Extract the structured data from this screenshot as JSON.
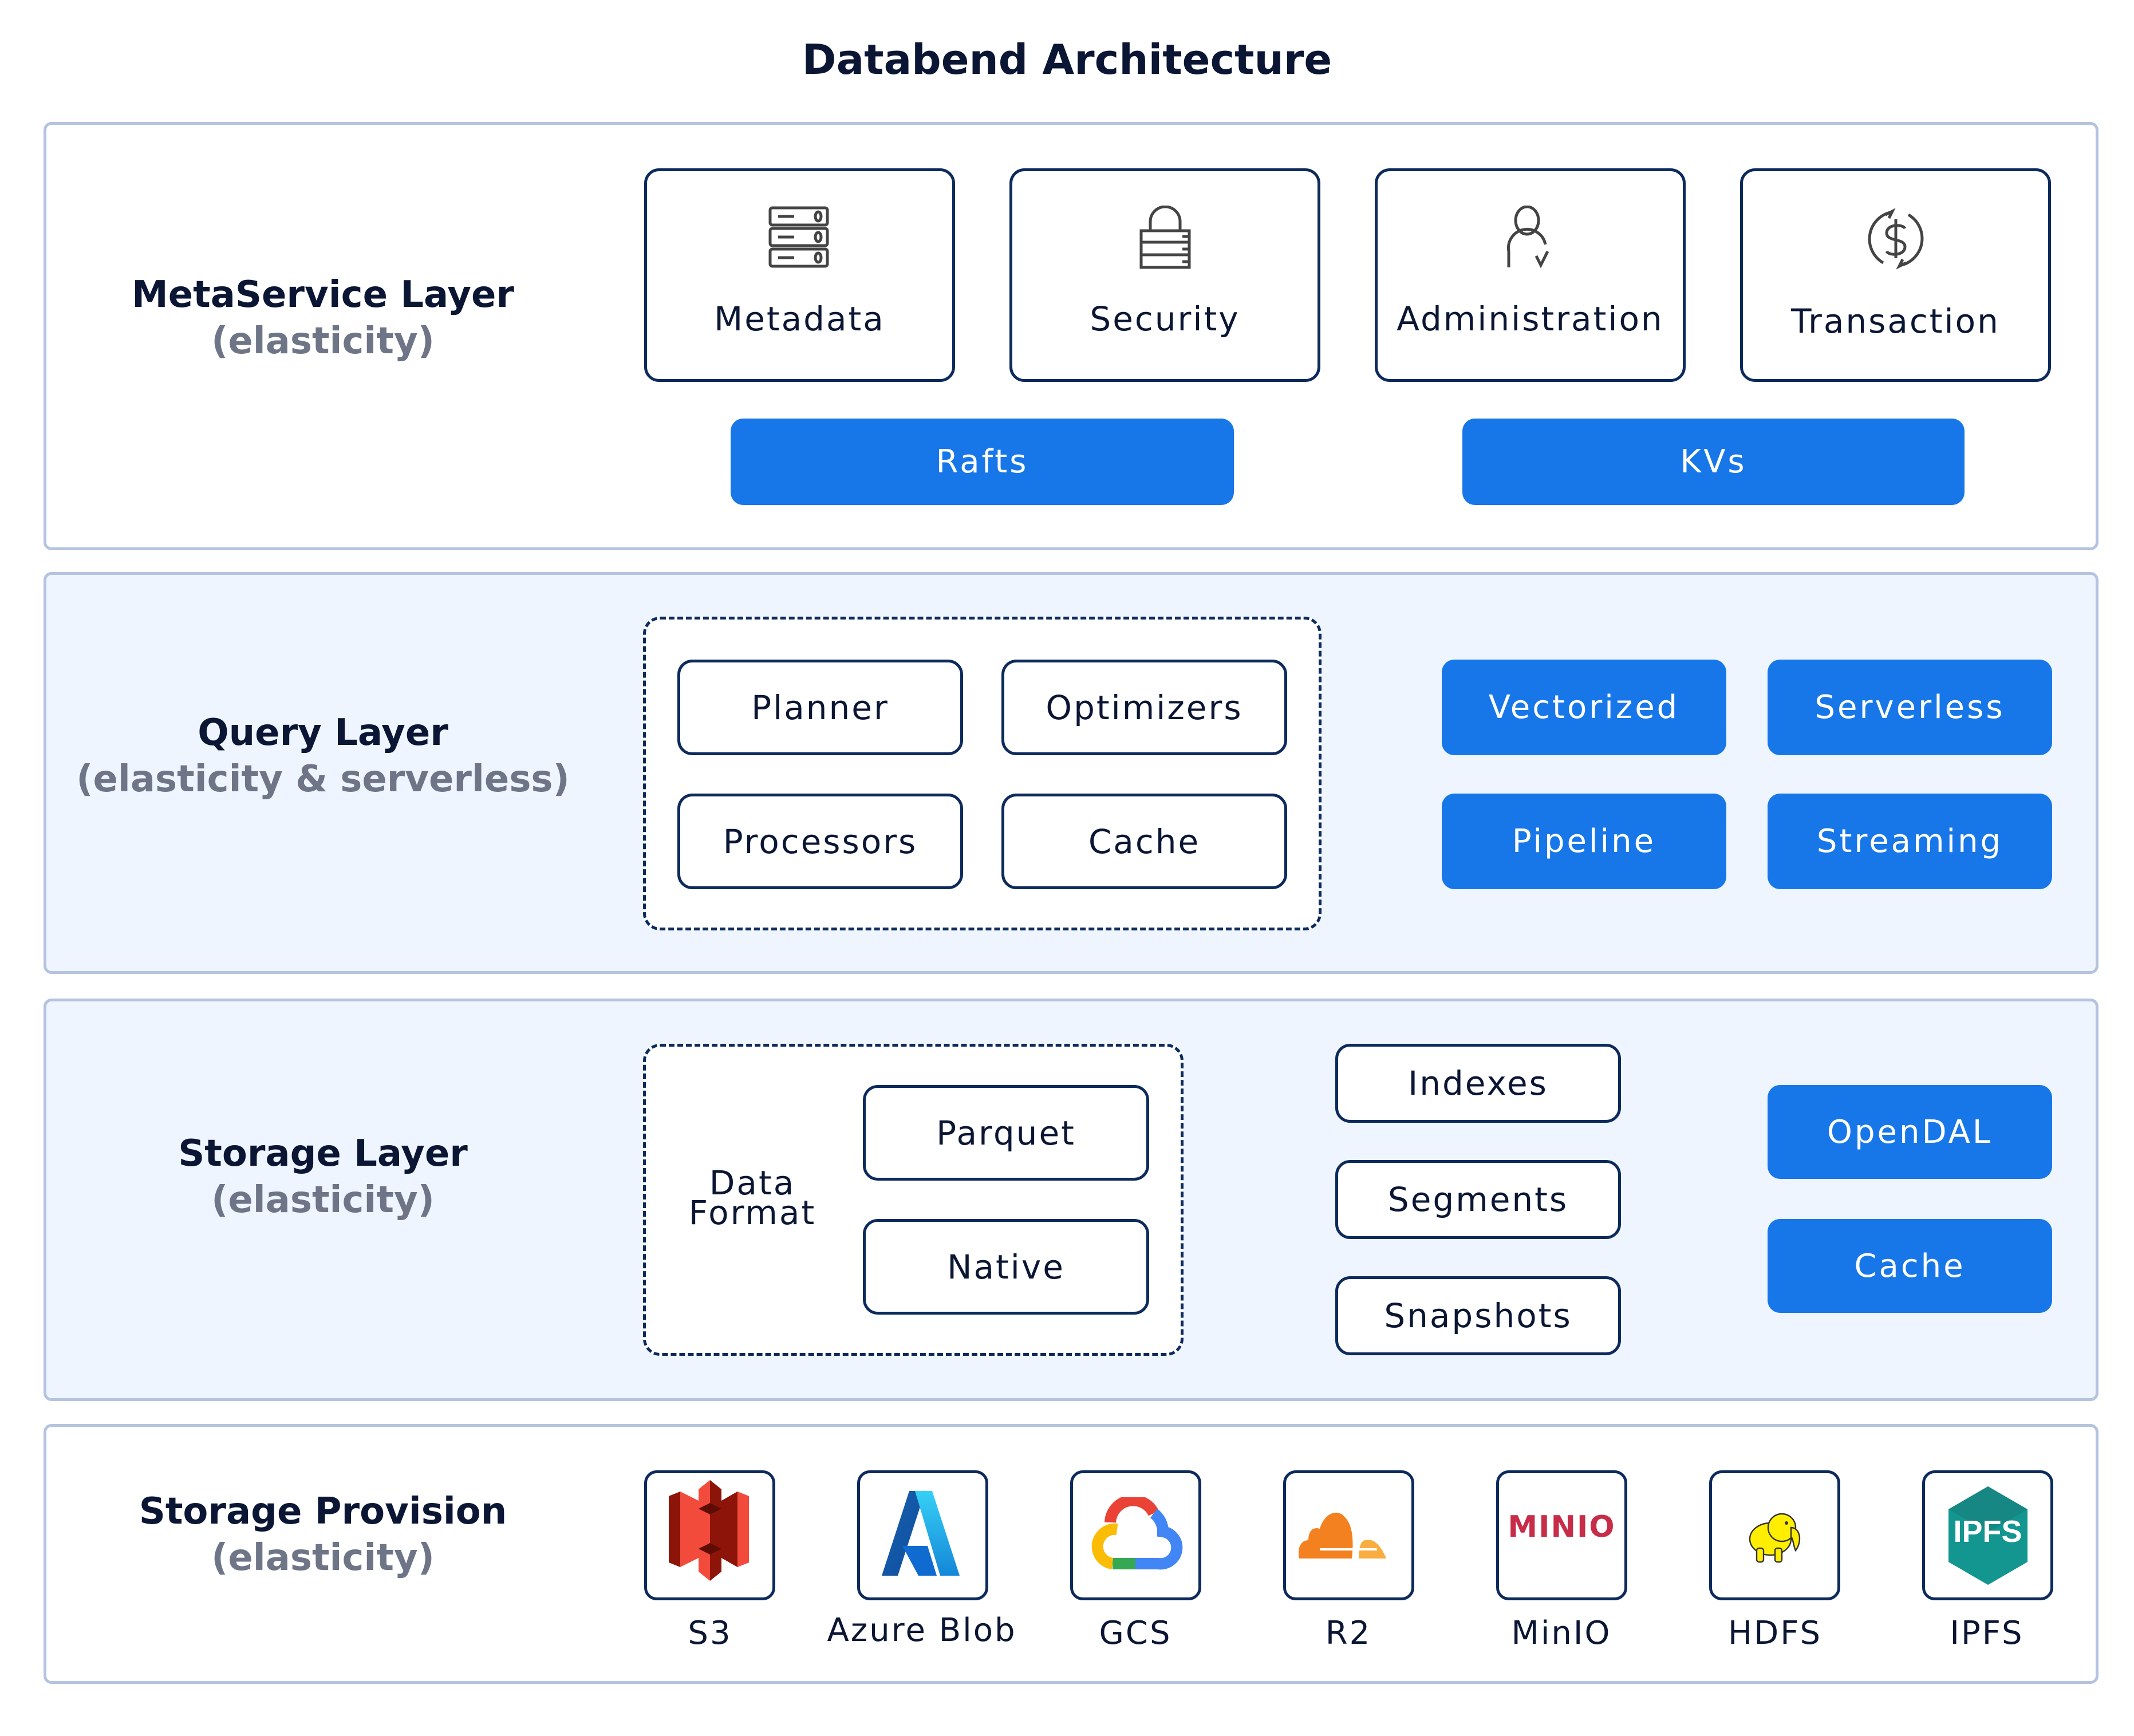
{
  "title": "Databend Architecture",
  "layers": {
    "meta": {
      "name": "MetaService Layer",
      "sub": "(elasticity)",
      "cards": [
        {
          "label": "Metadata",
          "icon": "server-stack-icon"
        },
        {
          "label": "Security",
          "icon": "lock-icon"
        },
        {
          "label": "Administration",
          "icon": "user-check-icon"
        },
        {
          "label": "Transaction",
          "icon": "dollar-cycle-icon"
        }
      ],
      "blocks": [
        "Rafts",
        "KVs"
      ]
    },
    "query": {
      "name": "Query Layer",
      "sub": "(elasticity & serverless)",
      "grouped": [
        "Planner",
        "Optimizers",
        "Processors",
        "Cache"
      ],
      "blocks": [
        "Vectorized",
        "Serverless",
        "Pipeline",
        "Streaming"
      ]
    },
    "storage": {
      "name": "Storage Layer",
      "sub": "(elasticity)",
      "data_format_label_line1": "Data",
      "data_format_label_line2": "Format",
      "formats": [
        "Parquet",
        "Native"
      ],
      "structures": [
        "Indexes",
        "Segments",
        "Snapshots"
      ],
      "blocks": [
        "OpenDAL",
        "Cache"
      ]
    },
    "provision": {
      "name": "Storage Provision",
      "sub": "(elasticity)",
      "providers": [
        {
          "label": "S3",
          "icon": "aws-s3-logo-icon"
        },
        {
          "label": "Azure Blob",
          "icon": "azure-logo-icon"
        },
        {
          "label": "GCS",
          "icon": "google-cloud-logo-icon"
        },
        {
          "label": "R2",
          "icon": "cloudflare-logo-icon"
        },
        {
          "label": "MinIO",
          "icon": "minio-logo-icon",
          "logo_text": "MINIO"
        },
        {
          "label": "HDFS",
          "icon": "hadoop-elephant-logo-icon"
        },
        {
          "label": "IPFS",
          "icon": "ipfs-logo-icon",
          "logo_text": "IPFS"
        }
      ]
    }
  },
  "colors": {
    "accent_blue": "#1877e8",
    "card_border": "#0c2a5c",
    "layer_border": "#b5c3df",
    "layer_tint": "#eef5fe",
    "text_dark": "#0a1633",
    "text_muted": "#6e7587"
  }
}
